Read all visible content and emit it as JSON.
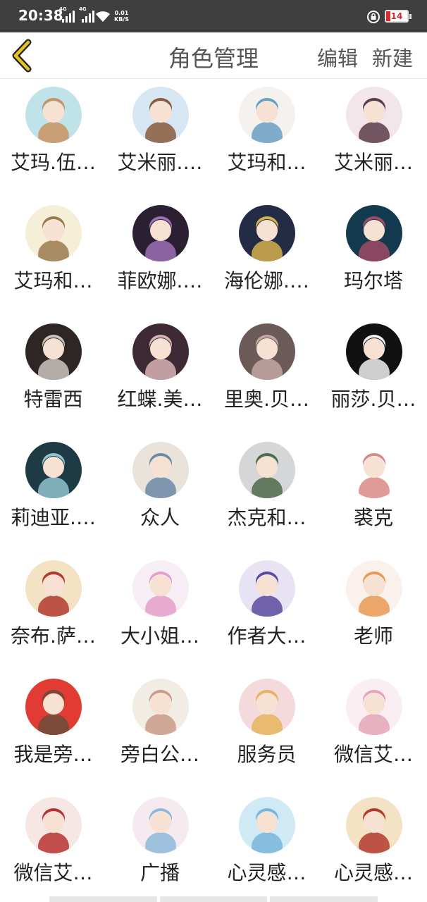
{
  "status_bar": {
    "time": "20:38",
    "signal_1_tag": "4G",
    "signal_2_tag": "4G",
    "net_speed_value": "0.01",
    "net_speed_unit": "KB/S",
    "battery_level": "14",
    "battery_color": "#d32f2f"
  },
  "header": {
    "title": "角色管理",
    "edit_label": "编辑",
    "new_label": "新建",
    "back_icon": "chevron-left-icon",
    "accent": "#e6c31e"
  },
  "roles": [
    {
      "name": "艾玛.伍…",
      "bg": "#bfe3e8",
      "fg": "#c9935f"
    },
    {
      "name": "艾米丽.…",
      "bg": "#d7e6f3",
      "fg": "#8a5a3c"
    },
    {
      "name": "艾玛和…",
      "bg": "#f4f1ee",
      "fg": "#6aa1c2"
    },
    {
      "name": "艾米丽…",
      "bg": "#f2e6ea",
      "fg": "#5b3c4a"
    },
    {
      "name": "艾玛和…",
      "bg": "#f5efd8",
      "fg": "#9a7a4f"
    },
    {
      "name": "菲欧娜.…",
      "bg": "#2a2031",
      "fg": "#9c6eb5"
    },
    {
      "name": "海伦娜.…",
      "bg": "#232b45",
      "fg": "#d6b04d"
    },
    {
      "name": "玛尔塔",
      "bg": "#143a4f",
      "fg": "#a04a64"
    },
    {
      "name": "特雷西",
      "bg": "#2e2624",
      "fg": "#c9c3bf"
    },
    {
      "name": "红蝶.美…",
      "bg": "#3d2a34",
      "fg": "#d8b3b6"
    },
    {
      "name": "里奥.贝…",
      "bg": "#6b5a58",
      "fg": "#c2a8a4"
    },
    {
      "name": "丽莎.贝…",
      "bg": "#111111",
      "fg": "#f0f0f0"
    },
    {
      "name": "莉迪亚.…",
      "bg": "#1e3a44",
      "fg": "#8fc4d0"
    },
    {
      "name": "众人",
      "bg": "#e9e3dc",
      "fg": "#6b8aa6"
    },
    {
      "name": "杰克和…",
      "bg": "#d4d6d8",
      "fg": "#4d6b4a"
    },
    {
      "name": "裘克",
      "bg": "#ffffff",
      "fg": "#d98a86"
    },
    {
      "name": "奈布.萨…",
      "bg": "#f3e3c4",
      "fg": "#b23a2f"
    },
    {
      "name": "大小姐…",
      "bg": "#f7eef5",
      "fg": "#e59fc8"
    },
    {
      "name": "作者大…",
      "bg": "#e8e3f2",
      "fg": "#5a4a9f"
    },
    {
      "name": "老师",
      "bg": "#fbf1ec",
      "fg": "#e79a53"
    },
    {
      "name": "我是旁…",
      "bg": "#e23b33",
      "fg": "#6b4c3a"
    },
    {
      "name": "旁白公…",
      "bg": "#f1ece4",
      "fg": "#c99b8a"
    },
    {
      "name": "服务员",
      "bg": "#f4d9dd",
      "fg": "#e7b45e"
    },
    {
      "name": "微信艾…",
      "bg": "#fbeef2",
      "fg": "#e3a6b9"
    },
    {
      "name": "微信艾…",
      "bg": "#f6e6e4",
      "fg": "#b8312f"
    },
    {
      "name": "广播",
      "bg": "#f5eaf0",
      "fg": "#8fb8d8"
    },
    {
      "name": "心灵感…",
      "bg": "#cfe9f5",
      "fg": "#7ab5d9"
    },
    {
      "name": "心灵感…",
      "bg": "#f3e3c4",
      "fg": "#b23a2f"
    }
  ]
}
